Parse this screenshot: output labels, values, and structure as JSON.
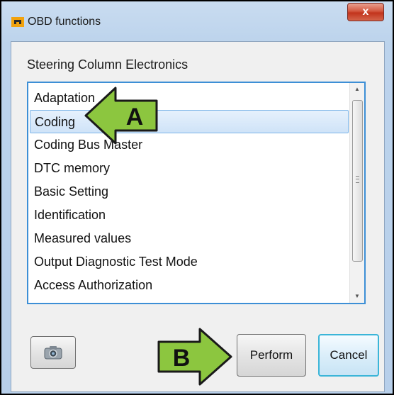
{
  "window": {
    "title": "OBD functions",
    "close_label": "x"
  },
  "group_label": "Steering Column Electronics",
  "list": {
    "selected_index": 1,
    "items": [
      {
        "label": "Adaptation"
      },
      {
        "label": "Coding"
      },
      {
        "label": "Coding Bus Master"
      },
      {
        "label": "DTC memory"
      },
      {
        "label": "Basic Setting"
      },
      {
        "label": "Identification"
      },
      {
        "label": "Measured values"
      },
      {
        "label": "Output Diagnostic Test Mode"
      },
      {
        "label": "Access Authorization"
      }
    ]
  },
  "buttons": {
    "perform_label": "Perform",
    "cancel_label": "Cancel",
    "camera_icon": "camera-icon"
  },
  "annotations": {
    "arrow_a_label": "A",
    "arrow_b_label": "B",
    "arrow_color": "#8cc63f"
  }
}
